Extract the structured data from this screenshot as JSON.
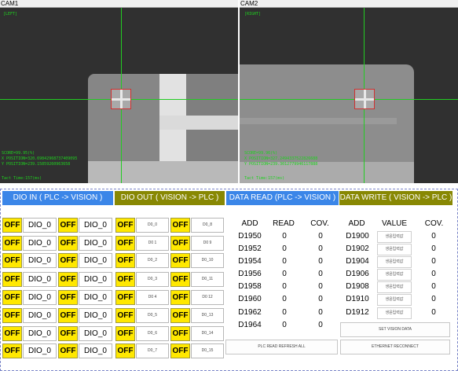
{
  "cam1": {
    "title": "CAM1",
    "side_label": "[LEFT]",
    "score": "SCORE=99.95(%)",
    "x_pos": "X POSITION=320.69842968737409095",
    "y_pos": "Y POSITION=239.15859260963658",
    "tact": "Tact Time:157(ms)"
  },
  "cam2": {
    "title": "CAM2",
    "side_label": "[RIGHT]",
    "score": "SCORE=99.96(%)",
    "x_pos": "X POSITION=327.2494337522826688",
    "y_pos": "Y POSITION=239.3012779946117888",
    "tact": "Tact Time:157(ms)"
  },
  "headers": {
    "dio_in": "DIO IN ( PLC -> VISION )",
    "dio_out": "DIO OUT ( VISION -> PLC )",
    "data_read": "DATA READ (PLC -> VISION )",
    "data_write": "DATA WRITE ( VISION -> PLC )"
  },
  "colors": {
    "dio_in": "#3b86e8",
    "dio_out": "#888803",
    "data_read": "#3b86e8",
    "data_write": "#888803",
    "off": "#ffe800"
  },
  "off_label": "OFF",
  "dio_in_rows": [
    [
      "DIO_0",
      "DIO_0"
    ],
    [
      "DIO_0",
      "DIO_0"
    ],
    [
      "DIO_0",
      "DIO_0"
    ],
    [
      "DIO_0",
      "DIO_0"
    ],
    [
      "DIO_0",
      "DIO_0"
    ],
    [
      "DIO_0",
      "DIO_0"
    ],
    [
      "DIO_0",
      "DIO_0"
    ],
    [
      "DIO_0",
      "DIO_0"
    ]
  ],
  "dio_out_rows": [
    [
      "D0_0",
      "D0_8"
    ],
    [
      "D0 1",
      "D0 9"
    ],
    [
      "D0_2",
      "D0_10"
    ],
    [
      "D0_3",
      "D0_11"
    ],
    [
      "D0 4",
      "D0 12"
    ],
    [
      "D0_5",
      "D0_13"
    ],
    [
      "D0_6",
      "D0_14"
    ],
    [
      "D0_7",
      "D0_15"
    ]
  ],
  "read_cols": [
    "ADD",
    "READ",
    "COV."
  ],
  "read_rows": [
    [
      "D1950",
      "0",
      "0"
    ],
    [
      "D1952",
      "0",
      "0"
    ],
    [
      "D1954",
      "0",
      "0"
    ],
    [
      "D1956",
      "0",
      "0"
    ],
    [
      "D1958",
      "0",
      "0"
    ],
    [
      "D1960",
      "0",
      "0"
    ],
    [
      "D1962",
      "0",
      "0"
    ],
    [
      "D1964",
      "0",
      "0"
    ]
  ],
  "write_cols": [
    "ADD",
    "VALUE",
    "COV."
  ],
  "write_rows": [
    [
      "D1900",
      "생윤입력값",
      "0"
    ],
    [
      "D1902",
      "생윤입력값",
      "0"
    ],
    [
      "D1904",
      "생윤입력값",
      "0"
    ],
    [
      "D1906",
      "생윤입력값",
      "0"
    ],
    [
      "D1908",
      "생윤입력값",
      "0"
    ],
    [
      "D1910",
      "생윤입력값",
      "0"
    ],
    [
      "D1912",
      "생윤입력값",
      "0"
    ]
  ],
  "buttons": {
    "plc_read_refresh": "PLC READ REFRESH ALL",
    "set_vision_data": "SET VISION DATA",
    "eth_connect": "ETHERNET RECONNECT"
  }
}
